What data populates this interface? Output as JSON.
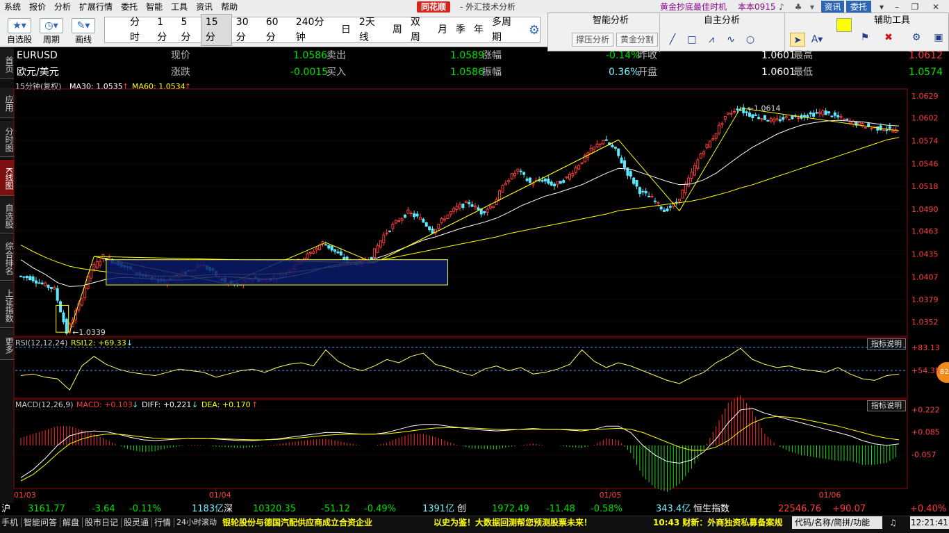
{
  "menu": {
    "items": [
      "系统",
      "报价",
      "分析",
      "扩展行情",
      "委托",
      "智能",
      "工具",
      "资讯",
      "帮助"
    ],
    "brand": "同花顺",
    "app_title": "- 外汇技术分析",
    "promo": "黄金抄底最佳时机",
    "version": "本本0915",
    "news_button": "资讯",
    "trade_button": "委托"
  },
  "toolbar": {
    "self_select": "自选股",
    "period": "周期",
    "draw": "画线",
    "periods": [
      "分时",
      "1分",
      "5分",
      "15分",
      "30分",
      "60分",
      "240分钟",
      "日",
      "2天线",
      "周",
      "双周",
      "月",
      "季",
      "年",
      "多周期"
    ],
    "active_period": "15分"
  },
  "tool_panel": {
    "smart_title": "智能分析",
    "self_title": "自主分析",
    "aux_title": "辅助工具",
    "support_btn": "撑压分析",
    "golden_btn": "黄金分割",
    "highlight_color": "#ffff00"
  },
  "left_tabs": [
    "首页",
    "应用",
    "分时图",
    "K线图",
    "自选股",
    "综合排名",
    "上证指数",
    "更多"
  ],
  "quote": {
    "symbol": "EURUSD",
    "name": "欧元/美元",
    "labels": {
      "price": "现价",
      "sell": "卖出",
      "change_pct": "涨幅",
      "prev_close": "昨收",
      "high": "最高",
      "change": "涨跌",
      "buy": "买入",
      "amplitude": "振幅",
      "open": "开盘",
      "low": "最低"
    },
    "price": "1.0586",
    "sell": "1.0589",
    "change_pct": "-0.14%",
    "prev_close": "1.0601",
    "high": "1.0612",
    "change": "-0.0015",
    "buy": "1.0586",
    "amplitude": "0.36%",
    "open": "1.0601",
    "low": "1.0574"
  },
  "indicators": {
    "period_label": "15分钟(复权)",
    "ma30": "MA30: 1.0535",
    "ma60": "MA60: 1.0534",
    "rsi": "RSI(12,12,24)",
    "rsi12": "RSI12: +69.33",
    "macd": "MACD(12,26,9)",
    "macd_val": "MACD: +0.103",
    "diff": "DIFF: +0.221",
    "dea": "DEA: +0.170",
    "explain": "指标说明",
    "orange_badge": "82"
  },
  "chart_data": {
    "type": "candlestick",
    "price_ticks": [
      "1.0629",
      "1.0602",
      "1.0574",
      "1.0546",
      "1.0518",
      "1.0490",
      "1.0463",
      "1.0435",
      "1.0407",
      "1.0379",
      "1.0352"
    ],
    "ylim": [
      1.0334,
      1.0634
    ],
    "x_dates": [
      "01/03",
      "01/04",
      "01/05",
      "01/06"
    ],
    "annotations": [
      "1.0614",
      "1.0339"
    ],
    "close_path": [
      1.0408,
      1.0406,
      1.0398,
      1.0392,
      1.0339,
      1.0372,
      1.0416,
      1.0432,
      1.0425,
      1.0418,
      1.041,
      1.0405,
      1.0402,
      1.0408,
      1.0414,
      1.0423,
      1.0412,
      1.04,
      1.0396,
      1.0405,
      1.0403,
      1.0406,
      1.0412,
      1.0426,
      1.0436,
      1.0449,
      1.0438,
      1.0426,
      1.0424,
      1.0432,
      1.0458,
      1.0474,
      1.0486,
      1.0478,
      1.0463,
      1.048,
      1.0492,
      1.0498,
      1.0486,
      1.0496,
      1.0524,
      1.0538,
      1.0522,
      1.0526,
      1.0519,
      1.0528,
      1.0545,
      1.0562,
      1.0575,
      1.0562,
      1.0534,
      1.0512,
      1.0503,
      1.0488,
      1.0498,
      1.0526,
      1.0558,
      1.0578,
      1.0604,
      1.0614,
      1.0606,
      1.0602,
      1.0598,
      1.0602,
      1.0604,
      1.0606,
      1.0609,
      1.0604,
      1.0598,
      1.0594,
      1.059,
      1.0589,
      1.0586
    ],
    "ma30_path": [
      1.0428,
      1.0418,
      1.041,
      1.04,
      1.0395,
      1.0396,
      1.04,
      1.0404,
      1.0406,
      1.0406,
      1.0405,
      1.0404,
      1.0403,
      1.0403,
      1.0404,
      1.0406,
      1.0407,
      1.0407,
      1.0406,
      1.0405,
      1.0404,
      1.0405,
      1.0407,
      1.041,
      1.0414,
      1.0419,
      1.0422,
      1.0424,
      1.0426,
      1.0429,
      1.0434,
      1.044,
      1.0446,
      1.0452,
      1.0456,
      1.0461,
      1.0466,
      1.047,
      1.0474,
      1.0479,
      1.0486,
      1.0494,
      1.05,
      1.0506,
      1.051,
      1.0515,
      1.052,
      1.0527,
      1.0534,
      1.054,
      1.0539,
      1.0534,
      1.0529,
      1.0524,
      1.052,
      1.0521,
      1.0526,
      1.0534,
      1.0545,
      1.0556,
      1.0566,
      1.0574,
      1.0582,
      1.0588,
      1.0593,
      1.0596,
      1.0598,
      1.0599,
      1.0598,
      1.0597,
      1.0595,
      1.0593,
      1.0592
    ],
    "ma60_path": [
      1.0446,
      1.0438,
      1.0431,
      1.0425,
      1.042,
      1.0417,
      1.0415,
      1.0413,
      1.0411,
      1.041,
      1.0409,
      1.0408,
      1.0408,
      1.0408,
      1.0408,
      1.0409,
      1.041,
      1.041,
      1.041,
      1.041,
      1.041,
      1.0411,
      1.0412,
      1.0414,
      1.0416,
      1.0418,
      1.042,
      1.0422,
      1.0424,
      1.0426,
      1.0429,
      1.0432,
      1.0435,
      1.0438,
      1.0441,
      1.0444,
      1.0447,
      1.045,
      1.0453,
      1.0456,
      1.046,
      1.0463,
      1.0466,
      1.0469,
      1.0472,
      1.0475,
      1.0478,
      1.0481,
      1.0484,
      1.0488,
      1.049,
      1.0492,
      1.0494,
      1.0496,
      1.0498,
      1.05,
      1.0503,
      1.0507,
      1.0511,
      1.0516,
      1.052,
      1.0525,
      1.053,
      1.0535,
      1.054,
      1.0545,
      1.055,
      1.0555,
      1.056,
      1.0565,
      1.057,
      1.0575,
      1.0578
    ],
    "rsi_ticks": [
      "+83.13",
      "+54.35"
    ],
    "rsi_path": [
      48,
      50,
      46,
      44,
      30,
      60,
      72,
      62,
      56,
      52,
      50,
      48,
      52,
      56,
      54,
      52,
      46,
      50,
      54,
      56,
      52,
      58,
      62,
      64,
      60,
      80,
      66,
      58,
      54,
      60,
      68,
      64,
      72,
      76,
      62,
      58,
      52,
      48,
      56,
      60,
      54,
      58,
      50,
      52,
      56,
      62,
      80,
      66,
      58,
      64,
      60,
      54,
      48,
      42,
      38,
      46,
      52,
      64,
      72,
      82,
      68,
      62,
      58,
      60,
      56,
      54,
      52,
      58,
      50,
      44,
      42,
      48,
      50
    ],
    "macd_ticks": [
      "+0.222",
      "+0.085",
      "-0.057"
    ],
    "macd_ylim": [
      -0.25,
      0.25
    ],
    "macd_diff": [
      -0.2,
      -0.15,
      -0.08,
      0.0,
      0.06,
      0.08,
      0.09,
      0.085,
      0.07,
      0.05,
      0.035,
      0.03,
      0.035,
      0.04,
      0.045,
      0.045,
      0.04,
      0.035,
      0.03,
      0.03,
      0.035,
      0.04,
      0.05,
      0.06,
      0.07,
      0.08,
      0.08,
      0.075,
      0.07,
      0.07,
      0.08,
      0.1,
      0.12,
      0.13,
      0.13,
      0.12,
      0.11,
      0.1,
      0.095,
      0.09,
      0.095,
      0.1,
      0.105,
      0.1,
      0.1,
      0.095,
      0.09,
      0.1,
      0.12,
      0.12,
      0.08,
      0.0,
      -0.06,
      -0.1,
      -0.11,
      -0.09,
      -0.04,
      0.04,
      0.14,
      0.22,
      0.23,
      0.2,
      0.18,
      0.16,
      0.14,
      0.12,
      0.1,
      0.08,
      0.06,
      0.03,
      0.01,
      0.0,
      0.01
    ],
    "macd_dea": [
      -0.22,
      -0.18,
      -0.12,
      -0.05,
      0.01,
      0.04,
      0.06,
      0.07,
      0.07,
      0.062,
      0.052,
      0.045,
      0.042,
      0.042,
      0.043,
      0.044,
      0.043,
      0.04,
      0.037,
      0.035,
      0.035,
      0.037,
      0.042,
      0.048,
      0.055,
      0.063,
      0.068,
      0.07,
      0.07,
      0.07,
      0.073,
      0.08,
      0.09,
      0.1,
      0.108,
      0.11,
      0.11,
      0.108,
      0.104,
      0.1,
      0.099,
      0.099,
      0.1,
      0.1,
      0.1,
      0.099,
      0.097,
      0.098,
      0.102,
      0.106,
      0.1,
      0.08,
      0.05,
      0.02,
      -0.01,
      -0.03,
      -0.03,
      -0.01,
      0.03,
      0.09,
      0.14,
      0.17,
      0.18,
      0.175,
      0.165,
      0.15,
      0.135,
      0.12,
      0.1,
      0.08,
      0.06,
      0.045,
      0.035
    ]
  },
  "indices": {
    "sh_label": "沪",
    "sh_value": "3161.77",
    "sh_change": "-3.64",
    "sh_pct": "-0.11%",
    "sh_volume": "1183亿",
    "sz_label": "深",
    "sz_value": "10320.35",
    "sz_change": "-51.12",
    "sz_pct": "-0.49%",
    "sz_volume": "1391亿",
    "cy_label": "创",
    "cy_value": "1972.49",
    "cy_change": "-11.48",
    "cy_pct": "-0.58%",
    "cy_volume": "343.4亿",
    "hs_label": "恒生指数",
    "hs_value": "22546.76",
    "hs_change": "+90.07",
    "hs_pct": "+0.40%"
  },
  "statusbar": {
    "items": [
      "手机",
      "智能问答",
      "解盘",
      "股市日记",
      "股灵通",
      "行情",
      "24小时滚动"
    ],
    "news1": "银轮股份与德国汽配供应商成立合资企业",
    "news2": "以史为鉴！大数据回测帮您预测股票未来！",
    "news3": "10:43 财新：外商独资私募备案规",
    "code_search": "代码/名称/简拼/功能",
    "time": "12:21:41"
  }
}
